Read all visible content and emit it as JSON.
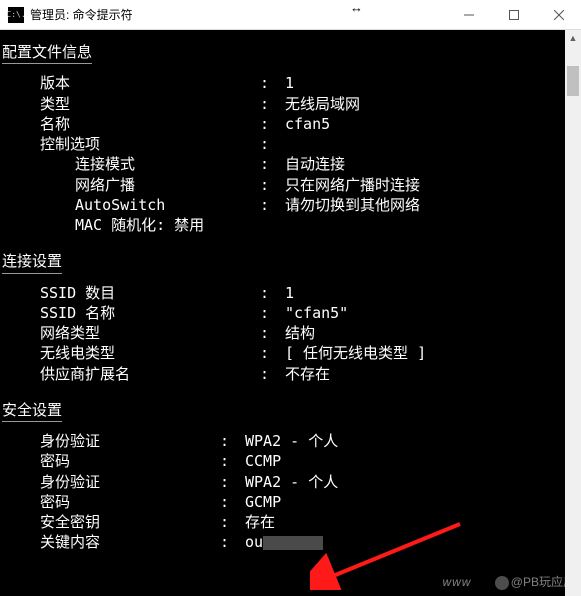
{
  "titlebar": {
    "icon_text": "C:\\.",
    "title": "管理员: 命令提示符"
  },
  "sections": {
    "profile": {
      "header": "配置文件信息",
      "rows": [
        {
          "key": "版本",
          "val": "1",
          "sub": false
        },
        {
          "key": "类型",
          "val": "无线局域网",
          "sub": false
        },
        {
          "key": "名称",
          "val": "cfan5",
          "sub": false
        },
        {
          "key": "控制选项",
          "val": "",
          "sub": false
        },
        {
          "key": "连接模式",
          "val": "自动连接",
          "sub": true
        },
        {
          "key": "网络广播",
          "val": "只在网络广播时连接",
          "sub": true
        },
        {
          "key": "AutoSwitch",
          "val": "请勿切换到其他网络",
          "sub": true
        },
        {
          "key": "MAC 随机化: 禁用",
          "val": "",
          "sub": true,
          "nocolon": true
        }
      ]
    },
    "conn": {
      "header": "连接设置",
      "rows": [
        {
          "key": "SSID 数目",
          "val": "1"
        },
        {
          "key": "SSID 名称",
          "val": "\"cfan5\""
        },
        {
          "key": "网络类型",
          "val": "结构"
        },
        {
          "key": "无线电类型",
          "val": "[ 任何无线电类型 ]"
        },
        {
          "key": "供应商扩展名",
          "val": "不存在"
        }
      ]
    },
    "security": {
      "header": "安全设置",
      "rows": [
        {
          "key": "身份验证",
          "val": "WPA2 - 个人"
        },
        {
          "key": "密码",
          "val": "CCMP"
        },
        {
          "key": "身份验证",
          "val": "WPA2 - 个人"
        },
        {
          "key": "密码",
          "val": "GCMP"
        },
        {
          "key": "安全密钥",
          "val": "存在"
        },
        {
          "key": "关键内容",
          "val": "ou",
          "redacted": true
        }
      ]
    }
  },
  "watermark": {
    "www": "www",
    "handle": "@PB玩应用"
  }
}
